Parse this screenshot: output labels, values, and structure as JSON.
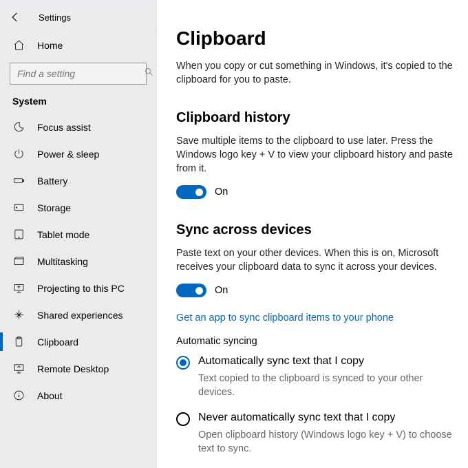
{
  "app": {
    "title": "Settings"
  },
  "sidebar": {
    "home_label": "Home",
    "search_placeholder": "Find a setting",
    "section_label": "System",
    "items": [
      {
        "label": "Focus assist",
        "icon": "moon"
      },
      {
        "label": "Power & sleep",
        "icon": "power"
      },
      {
        "label": "Battery",
        "icon": "battery"
      },
      {
        "label": "Storage",
        "icon": "storage"
      },
      {
        "label": "Tablet mode",
        "icon": "tablet"
      },
      {
        "label": "Multitasking",
        "icon": "multitask"
      },
      {
        "label": "Projecting to this PC",
        "icon": "project"
      },
      {
        "label": "Shared experiences",
        "icon": "shared"
      },
      {
        "label": "Clipboard",
        "icon": "clipboard",
        "selected": true
      },
      {
        "label": "Remote Desktop",
        "icon": "remote"
      },
      {
        "label": "About",
        "icon": "info"
      }
    ]
  },
  "main": {
    "title": "Clipboard",
    "intro": "When you copy or cut something in Windows, it's copied to the clipboard for you to paste.",
    "history": {
      "heading": "Clipboard history",
      "body": "Save multiple items to the clipboard to use later. Press the Windows logo key + V to view your clipboard history and paste from it.",
      "toggle_state": "On"
    },
    "sync": {
      "heading": "Sync across devices",
      "body": "Paste text on your other devices. When this is on, Microsoft receives your clipboard data to sync it across your devices.",
      "toggle_state": "On",
      "link": "Get an app to sync clipboard items to your phone",
      "auto_sync_label": "Automatic syncing",
      "options": [
        {
          "label": "Automatically sync text that I copy",
          "desc": "Text copied to the clipboard is synced to your other devices.",
          "checked": true
        },
        {
          "label": "Never automatically sync text that I copy",
          "desc": "Open clipboard history (Windows logo key + V) to choose text to sync.",
          "checked": false
        }
      ]
    }
  }
}
